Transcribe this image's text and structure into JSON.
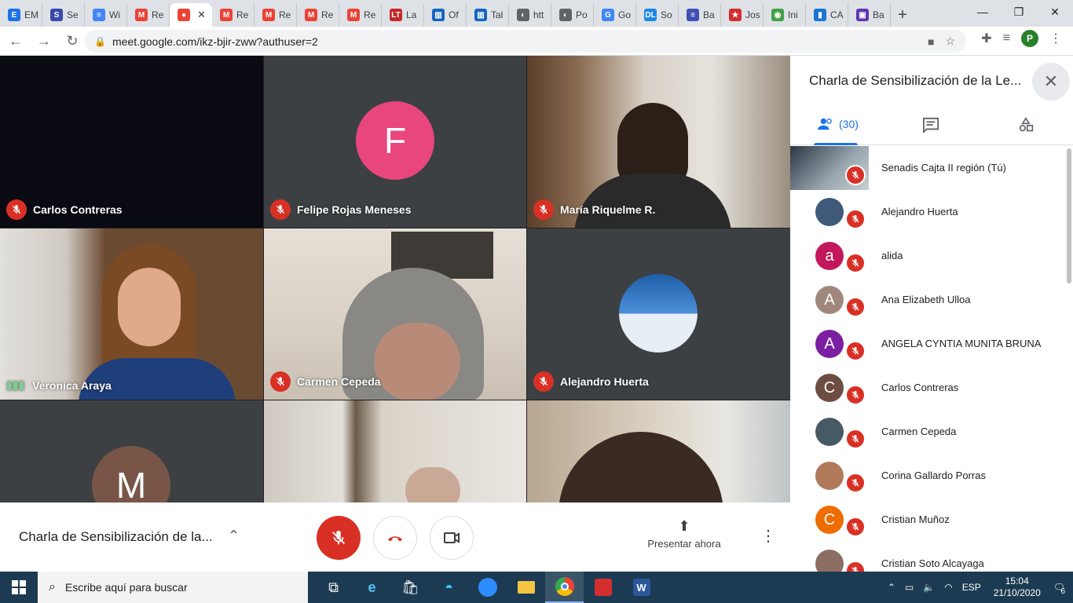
{
  "browser": {
    "tabs": [
      {
        "label": "EM",
        "color": "#1a73e8",
        "glyph": "E"
      },
      {
        "label": "Se",
        "color": "#3949ab",
        "glyph": "S"
      },
      {
        "label": "Wi",
        "color": "#4285f4",
        "glyph": "≡"
      },
      {
        "label": "Re",
        "color": "#ea4335",
        "glyph": "M"
      },
      {
        "label": "",
        "color": "#ea4335",
        "glyph": "●",
        "active": true
      },
      {
        "label": "Re",
        "color": "#ea4335",
        "glyph": "M"
      },
      {
        "label": "Re",
        "color": "#ea4335",
        "glyph": "M"
      },
      {
        "label": "Re",
        "color": "#ea4335",
        "glyph": "M"
      },
      {
        "label": "Re",
        "color": "#ea4335",
        "glyph": "M"
      },
      {
        "label": "La",
        "color": "#c62828",
        "glyph": "LT"
      },
      {
        "label": "Of",
        "color": "#1565c0",
        "glyph": "▥"
      },
      {
        "label": "Tal",
        "color": "#1565c0",
        "glyph": "▥"
      },
      {
        "label": "htt",
        "color": "#5f6368",
        "glyph": "◐"
      },
      {
        "label": "Po",
        "color": "#5f6368",
        "glyph": "◐"
      },
      {
        "label": "Go",
        "color": "#4285f4",
        "glyph": "G"
      },
      {
        "label": "So",
        "color": "#1e88e5",
        "glyph": "DL"
      },
      {
        "label": "Ba",
        "color": "#3f51b5",
        "glyph": "≡"
      },
      {
        "label": "Jos",
        "color": "#d32f2f",
        "glyph": "★"
      },
      {
        "label": "Ini",
        "color": "#43a047",
        "glyph": "◉"
      },
      {
        "label": "CA",
        "color": "#1976d2",
        "glyph": "▮"
      },
      {
        "label": "Ba",
        "color": "#5e35b1",
        "glyph": "▣"
      }
    ],
    "url": "meet.google.com/ikz-bjir-zww?authuser=2",
    "profile_initial": "P"
  },
  "grid": {
    "tiles": [
      {
        "name": "Carlos Contreras",
        "muted": true
      },
      {
        "name": "Felipe Rojas Meneses",
        "muted": true,
        "avatar_letter": "F",
        "avatar_color": "#e8467c"
      },
      {
        "name": "María Riquelme R.",
        "muted": true
      },
      {
        "name": "Veronica Araya",
        "muted": false
      },
      {
        "name": "Carmen Cepeda",
        "muted": true
      },
      {
        "name": "Alejandro Huerta",
        "muted": true
      },
      {
        "name": "",
        "muted": true,
        "avatar_letter": "M",
        "avatar_color": "#795548"
      },
      {
        "name": "",
        "muted": true
      },
      {
        "name": "",
        "muted": true
      }
    ]
  },
  "bottombar": {
    "meeting_title": "Charla de Sensibilización de la...",
    "present_label": "Presentar ahora"
  },
  "panel": {
    "title": "Charla de Sensibilización de la Le...",
    "people_count": "(30)",
    "participants": [
      {
        "name": "Senadis Cajta II región (Tú)",
        "letter": "",
        "color": "",
        "self": true
      },
      {
        "name": "Alejandro Huerta",
        "letter": "",
        "color": "#3e5a78"
      },
      {
        "name": "alida",
        "letter": "a",
        "color": "#c2185b"
      },
      {
        "name": "Ana Elizabeth Ulloa",
        "letter": "A",
        "color": "#a1887f"
      },
      {
        "name": "ANGELA CYNTIA MUNITA BRUNA",
        "letter": "A",
        "color": "#7b1fa2"
      },
      {
        "name": "Carlos Contreras",
        "letter": "C",
        "color": "#6d4c41"
      },
      {
        "name": "Carmen Cepeda",
        "letter": "",
        "color": "#455a64"
      },
      {
        "name": "Corina Gallardo Porras",
        "letter": "",
        "color": "#b07a5a"
      },
      {
        "name": "Cristian Muñoz",
        "letter": "C",
        "color": "#ef6c00"
      },
      {
        "name": "Cristian Soto Alcayaga",
        "letter": "",
        "color": "#8d6e63"
      }
    ]
  },
  "taskbar": {
    "search_placeholder": "Escribe aquí para buscar",
    "language": "ESP",
    "time": "15:04",
    "date": "21/10/2020",
    "notification_count": "6"
  }
}
